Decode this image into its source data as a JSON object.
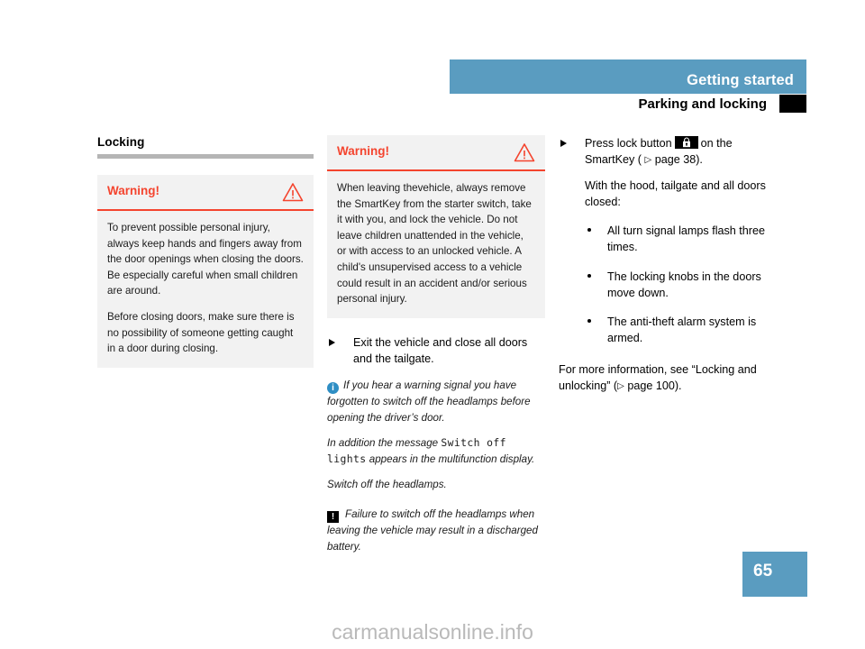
{
  "header": {
    "band_title": "Getting started",
    "sub_title": "Parking and locking",
    "band_color": "#5a9cc0"
  },
  "left_column": {
    "section_heading": "Locking",
    "warning": {
      "title": "Warning!",
      "icon": "warning-triangle-icon",
      "accent_color": "#f4442e",
      "paragraphs": [
        "To prevent possible personal injury, always keep hands and fingers away from the door openings when closing the doors. Be especially careful when small children are around.",
        "Before closing doors, make sure there is no possibility of someone getting caught in a door during closing."
      ]
    }
  },
  "middle_column": {
    "warning": {
      "title": "Warning!",
      "icon": "warning-triangle-icon",
      "accent_color": "#f4442e",
      "paragraphs": [
        "When leaving thevehicle, always remove the SmartKey from the starter switch, take it with you, and lock the vehicle. Do not leave children unattended in the vehicle, or with access to an unlocked vehicle. A child's unsupervised access to a vehicle could result in an accident and/or serious personal injury."
      ]
    },
    "step": "Exit the vehicle and close all doors and the tailgate.",
    "note_info": {
      "icon": "info-circle-icon",
      "text": "If you hear a warning signal you have forgotten to switch off the headlamps before opening the driver’s door."
    },
    "note_message_prefix": "In addition the message",
    "note_message_mono": "Switch off lights",
    "note_message_suffix": "appears in the multifunction display.",
    "note_action": "Switch off the headlamps.",
    "note_caution": {
      "icon": "exclamation-box-icon",
      "text": "Failure to switch off the headlamps when leaving the vehicle may result in a discharged battery."
    }
  },
  "right_column": {
    "step_prefix": "Press lock button",
    "step_lock_icon": "lock-button-icon",
    "step_suffix": "on the SmartKey (",
    "step_ref_arrow": "▷",
    "step_ref_page": "page 38).",
    "condition": "With the hood, tailgate and all doors closed:",
    "bullets": [
      "All turn signal lamps flash three times.",
      "The locking knobs in the doors move down.",
      "The anti-theft alarm system is armed."
    ],
    "footer_prefix": "For more information, see “Locking and unlocking” (",
    "footer_ref_arrow": "▷",
    "footer_ref_page": "page 100)."
  },
  "footer": {
    "page_number": "65",
    "watermark": "carmanualsonline.info"
  }
}
